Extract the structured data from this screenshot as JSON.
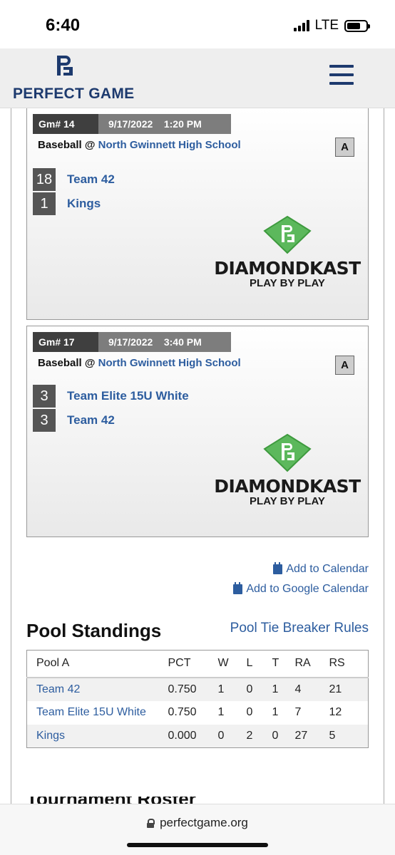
{
  "status_bar": {
    "time": "6:40",
    "network": "LTE"
  },
  "header": {
    "brand": "PERFECT GAME"
  },
  "games": [
    {
      "game_number": "Gm# 14",
      "datetime": "9/17/2022    1:20 PM",
      "sport_prefix": "Baseball @ ",
      "venue": "North Gwinnett High School",
      "pool": "A",
      "teams": [
        {
          "score": "18",
          "name": "Team 42"
        },
        {
          "score": "1",
          "name": "Kings"
        }
      ],
      "broadcast_brand": "DIAMONDKAST",
      "broadcast_sub": "PLAY BY PLAY"
    },
    {
      "game_number": "Gm# 17",
      "datetime": "9/17/2022    3:40 PM",
      "sport_prefix": "Baseball @ ",
      "venue": "North Gwinnett High School",
      "pool": "A",
      "teams": [
        {
          "score": "3",
          "name": "Team Elite 15U White"
        },
        {
          "score": "3",
          "name": "Team 42"
        }
      ],
      "broadcast_brand": "DIAMONDKAST",
      "broadcast_sub": "PLAY BY PLAY"
    }
  ],
  "calendar": {
    "add_calendar": "Add to Calendar",
    "add_google_calendar": "Add to Google Calendar"
  },
  "standings": {
    "title": "Pool Standings",
    "tie_breaker_link": "Pool Tie Breaker Rules",
    "columns": [
      "Pool A",
      "PCT",
      "W",
      "L",
      "T",
      "RA",
      "RS"
    ],
    "rows": [
      [
        "Team 42",
        "0.750",
        "1",
        "0",
        "1",
        "4",
        "21"
      ],
      [
        "Team Elite 15U White",
        "0.750",
        "1",
        "0",
        "1",
        "7",
        "12"
      ],
      [
        "Kings",
        "0.000",
        "0",
        "2",
        "0",
        "27",
        "5"
      ]
    ]
  },
  "partial_heading": "Tournament Roster",
  "browser": {
    "url": "perfectgame.org"
  },
  "colors": {
    "brand_navy": "#1d3a6e",
    "link_blue": "#2d5d9f",
    "diamond_green": "#5cb85c"
  }
}
